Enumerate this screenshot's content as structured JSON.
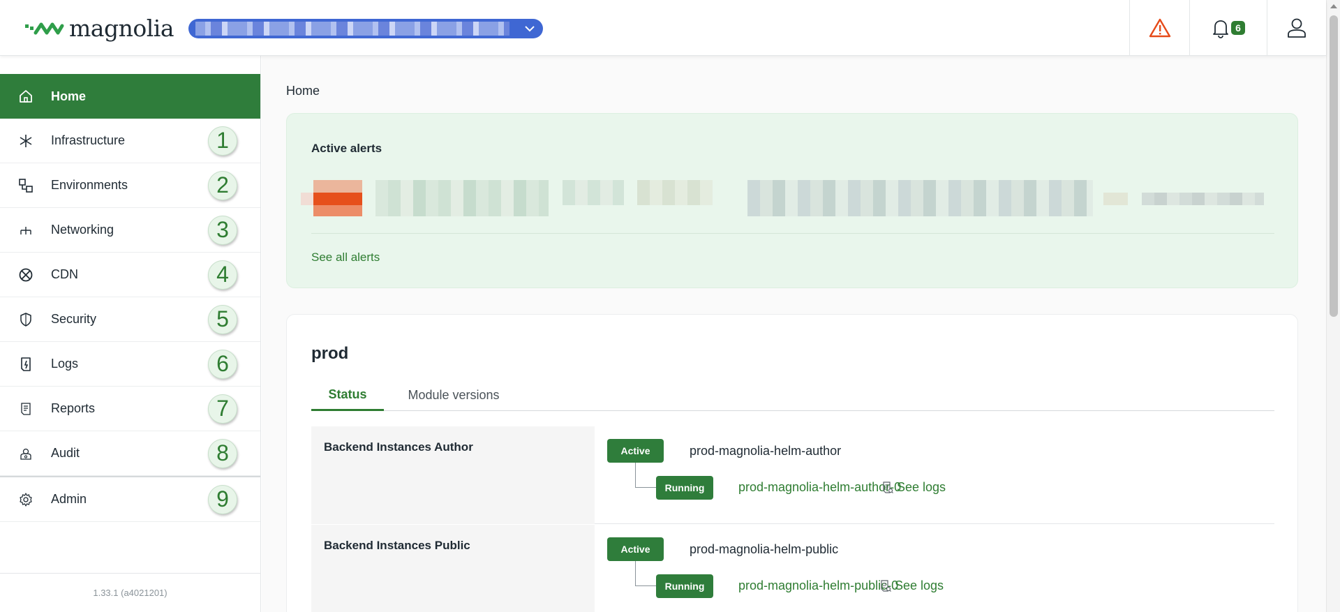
{
  "header": {
    "logo_text": "magnolia",
    "env_selector": {
      "value": "",
      "icon": "chevron-down-icon"
    },
    "alert_icon": "warning-triangle-icon",
    "notifications": {
      "icon": "bell-icon",
      "count": "6"
    },
    "user_icon": "user-icon"
  },
  "sidebar": {
    "items": [
      {
        "label": "Home",
        "icon": "home-icon",
        "active": true,
        "number": ""
      },
      {
        "label": "Infrastructure",
        "icon": "asterisk-icon",
        "number": "1"
      },
      {
        "label": "Environments",
        "icon": "environments-icon",
        "number": "2"
      },
      {
        "label": "Networking",
        "icon": "network-icon",
        "number": "3"
      },
      {
        "label": "CDN",
        "icon": "cdn-icon",
        "number": "4"
      },
      {
        "label": "Security",
        "icon": "shield-icon",
        "number": "5"
      },
      {
        "label": "Logs",
        "icon": "logs-icon",
        "number": "6"
      },
      {
        "label": "Reports",
        "icon": "report-icon",
        "number": "7"
      },
      {
        "label": "Audit",
        "icon": "audit-icon",
        "number": "8"
      },
      {
        "label": "Admin",
        "icon": "gear-icon",
        "number": "9"
      }
    ],
    "version": "1.33.1 (a4021201)"
  },
  "main": {
    "breadcrumb": "Home",
    "alerts": {
      "title": "Active alerts",
      "see_all": "See all alerts"
    },
    "environment": {
      "name": "prod",
      "tabs": [
        {
          "label": "Status",
          "active": true
        },
        {
          "label": "Module versions",
          "active": false
        }
      ],
      "rows": [
        {
          "label": "Backend Instances Author",
          "status": "Active",
          "service": "prod-magnolia-helm-author",
          "pod_status": "Running",
          "pod": "prod-magnolia-helm-author-0",
          "logs": "See logs"
        },
        {
          "label": "Backend Instances Public",
          "status": "Active",
          "service": "prod-magnolia-helm-public",
          "pod_status": "Running",
          "pod": "prod-magnolia-helm-public-0",
          "logs": "See logs"
        }
      ]
    }
  },
  "colors": {
    "brand_green": "#2f7d3b",
    "alert_bg": "#e9f6ec",
    "env_selector_bg": "#3f67d3",
    "warning": "#e64a19"
  }
}
